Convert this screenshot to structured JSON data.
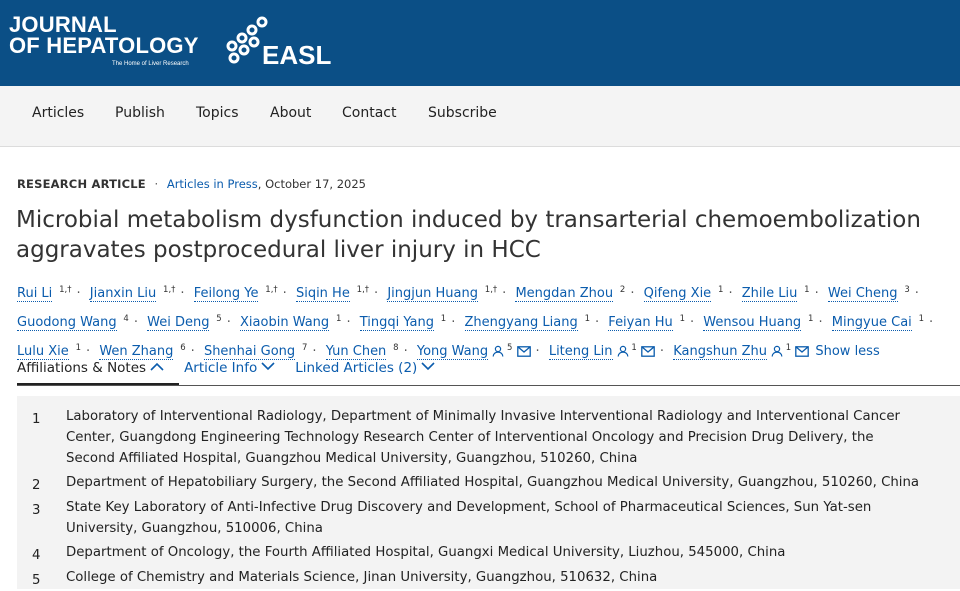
{
  "header": {
    "journal_line1": "JOURNAL",
    "journal_line2": "OF HEPATOLOGY",
    "journal_tagline": "The Home of Liver Research",
    "easl_logo": "EASL",
    "background": "#0b4f86"
  },
  "nav": {
    "items": [
      "Articles",
      "Publish",
      "Topics",
      "About",
      "Contact",
      "Subscribe"
    ]
  },
  "article": {
    "type": "RESEARCH ARTICLE",
    "dot": "·",
    "section_link": "Articles in Press",
    "date": ", October 17, 2025",
    "title_line1": "Microbial metabolism dysfunction induced by transarterial chemoembolization",
    "title_line2": "aggravates postprocedural liver injury in HCC"
  },
  "authors": [
    {
      "name": "Rui Li",
      "sup": "1,†"
    },
    {
      "name": "Jianxin Liu",
      "sup": "1,†"
    },
    {
      "name": "Feilong Ye",
      "sup": "1,†"
    },
    {
      "name": "Siqin He",
      "sup": "1,†"
    },
    {
      "name": "Jingjun Huang",
      "sup": "1,†"
    },
    {
      "name": "Mengdan Zhou",
      "sup": "2"
    },
    {
      "name": "Qifeng Xie",
      "sup": "1"
    },
    {
      "name": "Zhile Liu",
      "sup": "1"
    },
    {
      "name": "Wei Cheng",
      "sup": "3"
    },
    {
      "name": "Guodong Wang",
      "sup": "4"
    },
    {
      "name": "Wei Deng",
      "sup": "5"
    },
    {
      "name": "Xiaobin Wang",
      "sup": "1"
    },
    {
      "name": "Tingqi Yang",
      "sup": "1"
    },
    {
      "name": "Zhengyang Liang",
      "sup": "1"
    },
    {
      "name": "Feiyan Hu",
      "sup": "1"
    },
    {
      "name": "Wensou Huang",
      "sup": "1"
    },
    {
      "name": "Mingyue Cai",
      "sup": "1"
    },
    {
      "name": "Lulu Xie",
      "sup": "1"
    },
    {
      "name": "Wen Zhang",
      "sup": "6"
    },
    {
      "name": "Shenhai Gong",
      "sup": "7"
    },
    {
      "name": "Yun Chen",
      "sup": "8"
    },
    {
      "name": "Yong Wang",
      "sup": "5",
      "corresponding": true
    },
    {
      "name": "Liteng Lin",
      "sup": "1",
      "corresponding": true
    },
    {
      "name": "Kangshun Zhu",
      "sup": "1",
      "corresponding": true
    }
  ],
  "authors_meta": {
    "separator": "·",
    "show_less": "Show less"
  },
  "tabs": [
    {
      "label": "Affiliations & Notes",
      "active": true,
      "chevron": "up"
    },
    {
      "label": "Article Info",
      "active": false,
      "chevron": "down"
    },
    {
      "label": "Linked Articles (2)",
      "active": false,
      "chevron": "down"
    }
  ],
  "affiliations": [
    {
      "num": "1",
      "lines": [
        "Laboratory of Interventional Radiology, Department of Minimally Invasive Interventional Radiology and Interventional Cancer",
        "Center, Guangdong Engineering Technology Research Center of Interventional Oncology and Precision Drug Delivery, the",
        "Second Affiliated Hospital, Guangzhou Medical University, Guangzhou, 510260, China"
      ]
    },
    {
      "num": "2",
      "lines": [
        "Department of Hepatobiliary Surgery, the Second Affiliated Hospital, Guangzhou Medical University, Guangzhou, 510260, China"
      ]
    },
    {
      "num": "3",
      "lines": [
        "State Key Laboratory of Anti-Infective Drug Discovery and Development, School of Pharmaceutical Sciences, Sun Yat-sen",
        "University, Guangzhou, 510006, China"
      ]
    },
    {
      "num": "4",
      "lines": [
        "Department of Oncology, the Fourth Affiliated Hospital, Guangxi Medical University, Liuzhou, 545000, China"
      ]
    },
    {
      "num": "5",
      "lines": [
        "College of Chemistry and Materials Science, Jinan University, Guangzhou, 510632, China"
      ]
    }
  ],
  "colors": {
    "header_blue": "#0b4f86",
    "link_blue": "#0b5cad",
    "panel_gray": "#f3f3f3"
  }
}
